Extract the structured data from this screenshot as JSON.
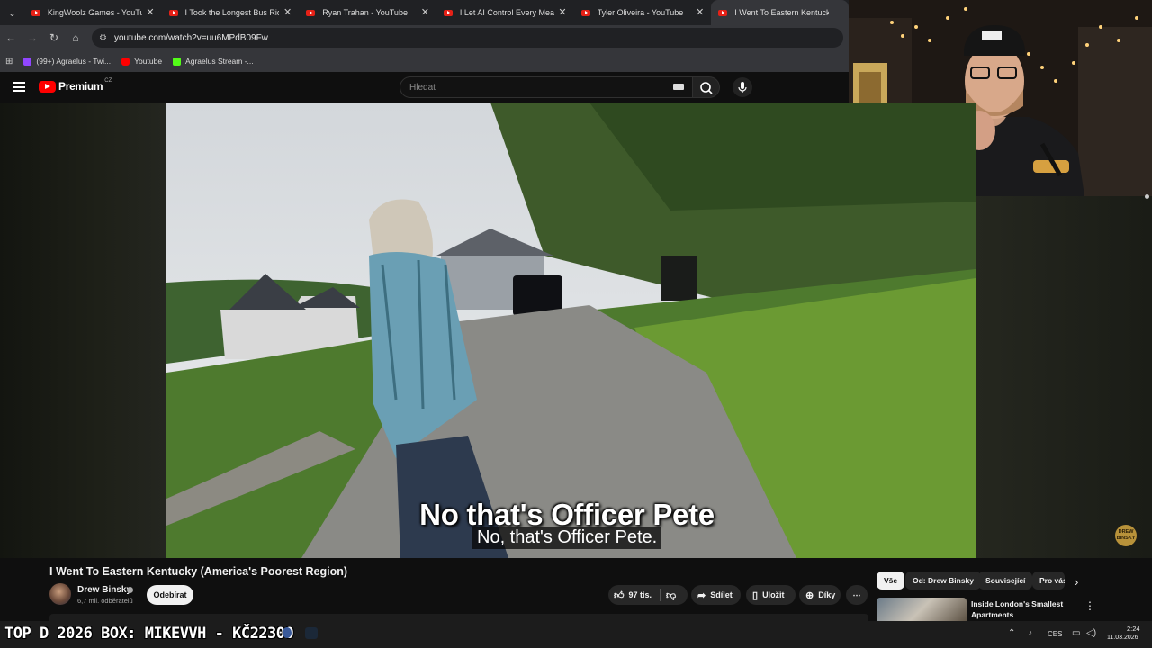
{
  "browser": {
    "tabs": [
      {
        "title": "KingWoolz Games - YouTube",
        "active": false
      },
      {
        "title": "I Took the Longest Bus Ride in...",
        "active": false
      },
      {
        "title": "Ryan Trahan - YouTube",
        "active": false
      },
      {
        "title": "I Let AI Control Every Meal for...",
        "active": false
      },
      {
        "title": "Tyler Oliveira - YouTube",
        "active": false
      },
      {
        "title": "I Went To Eastern Kentucky",
        "active": true
      }
    ],
    "tab_close_glyph": "✕",
    "tab_list_glyph": "⌄",
    "url": "youtube.com/watch?v=uu6MPdB09Fw",
    "bookmarks": [
      {
        "label": "(99+) Agraelus - Twi...",
        "color": "#9146ff"
      },
      {
        "label": "Youtube",
        "color": "#ff0000"
      },
      {
        "label": "Agraelus Stream -...",
        "color": "#53fc18"
      }
    ]
  },
  "youtube": {
    "brand": "Premium",
    "country_code": "CZ",
    "search_placeholder": "Hledat",
    "video": {
      "title": "I Went To Eastern Kentucky (America's Poorest Region)",
      "subtitle_burned": "No that's Officer Pete",
      "subtitle_cc": "No, that's Officer Pete.",
      "watermark": "DREW BINSKY"
    },
    "channel": {
      "name": "Drew Binsky",
      "subscribers": "6,7 mil. odběratelů",
      "subscribe_label": "Odebírat"
    },
    "actions": {
      "likes": "97 tis.",
      "share": "Sdílet",
      "save": "Uložit",
      "thanks": "Díky",
      "more": "⋯"
    },
    "chips": [
      {
        "label": "Vše",
        "active": true
      },
      {
        "label": "Od: Drew Binsky",
        "active": false
      },
      {
        "label": "Související",
        "active": false
      },
      {
        "label": "Pro vás",
        "active": false
      }
    ],
    "recommended": {
      "title": "Inside London's Smallest Apartments"
    }
  },
  "stream_overlay": {
    "donation_banner": "TOP D 2026 BOX: MIKEVVH - KČ22300"
  },
  "taskbar": {
    "language": "CES",
    "time": "2:24",
    "date": "11.03.2026"
  },
  "colors": {
    "yt_red": "#ff0000",
    "chrome_dark": "#202124",
    "chrome_mid": "#35363a",
    "yt_bg": "#0f0f0f"
  }
}
